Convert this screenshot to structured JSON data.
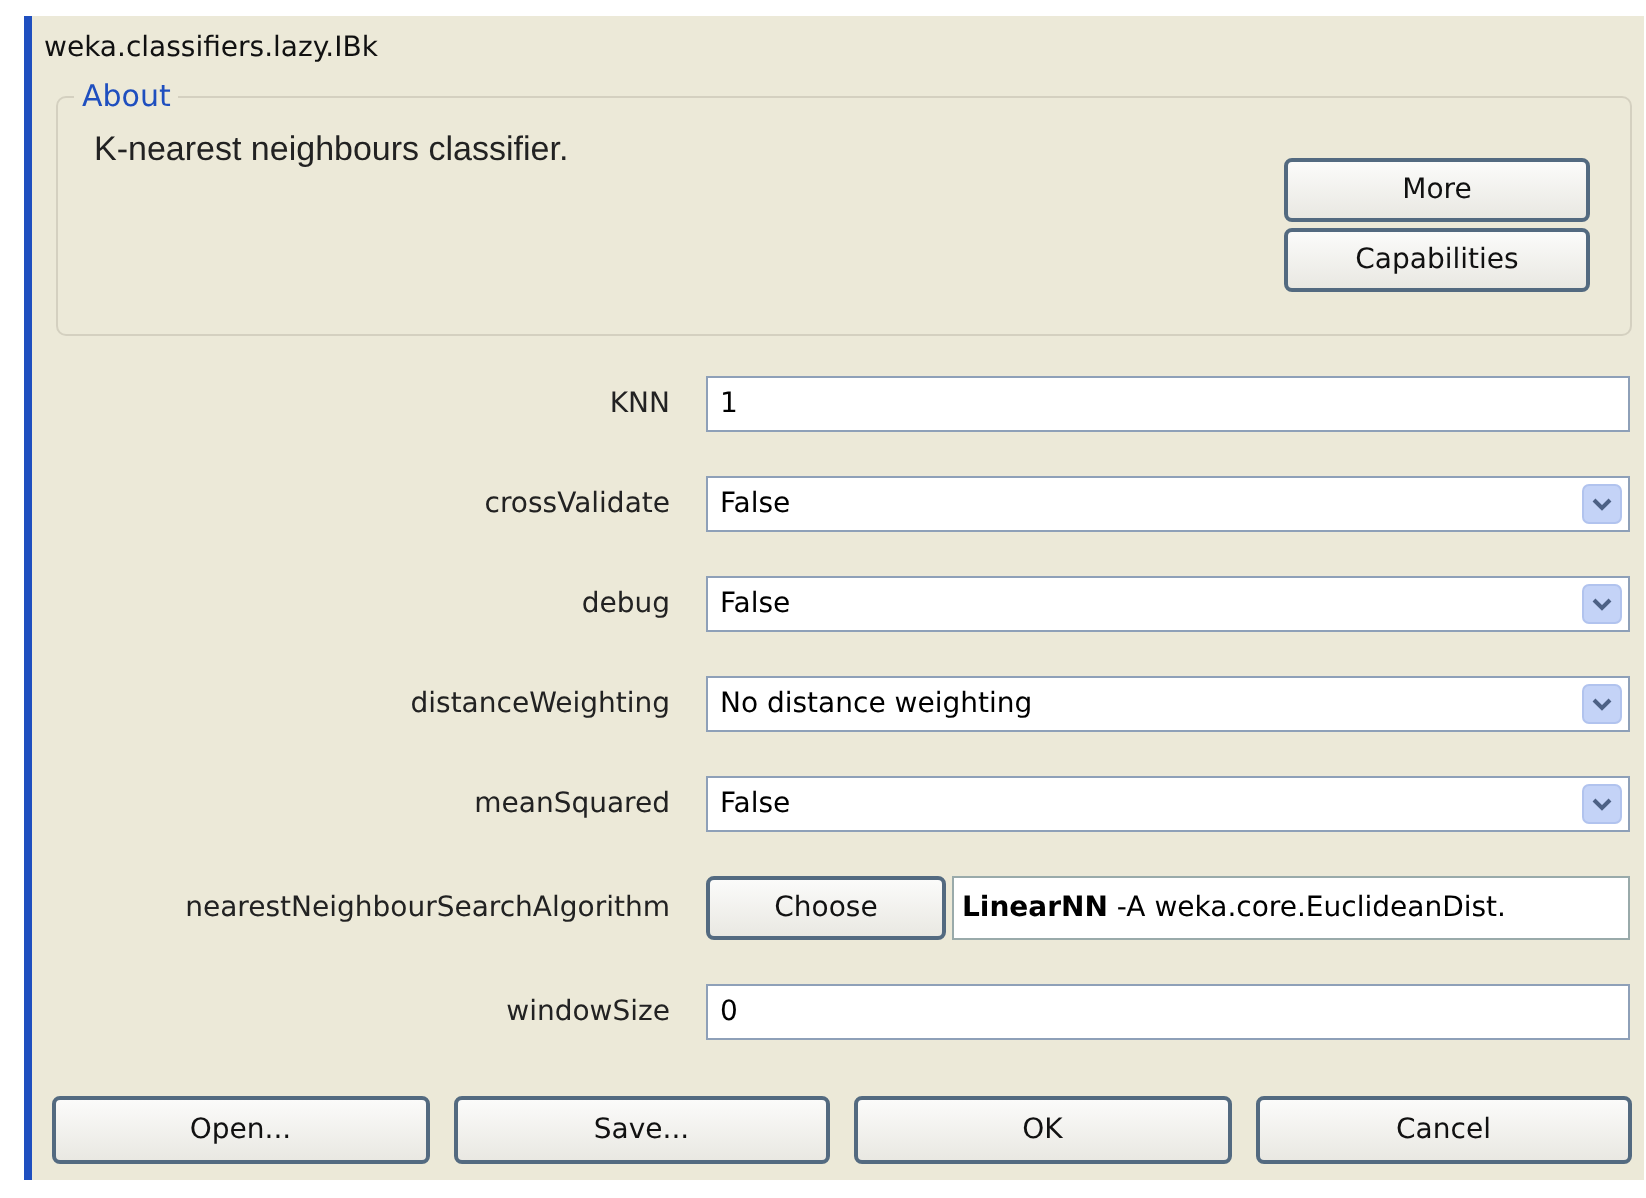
{
  "window": {
    "title": "weka.classifiers.lazy.IBk"
  },
  "about": {
    "legend": "About",
    "text": "K-nearest neighbours classifier.",
    "buttons": [
      "More",
      "Capabilities"
    ]
  },
  "properties": [
    {
      "label": "KNN",
      "kind": "text",
      "value": "1"
    },
    {
      "label": "crossValidate",
      "kind": "select",
      "value": "False"
    },
    {
      "label": "debug",
      "kind": "select",
      "value": "False"
    },
    {
      "label": "distanceWeighting",
      "kind": "select",
      "value": "No distance weighting"
    },
    {
      "label": "meanSquared",
      "kind": "select",
      "value": "False"
    },
    {
      "label": "nearestNeighbourSearchAlgorithm",
      "kind": "object",
      "button": "Choose",
      "value": "**LinearNN** -A weka.core.EuclideanDist."
    },
    {
      "label": "windowSize",
      "kind": "text",
      "value": "0"
    }
  ],
  "buttons": [
    "Open...",
    "Save...",
    "OK",
    "Cancel"
  ]
}
